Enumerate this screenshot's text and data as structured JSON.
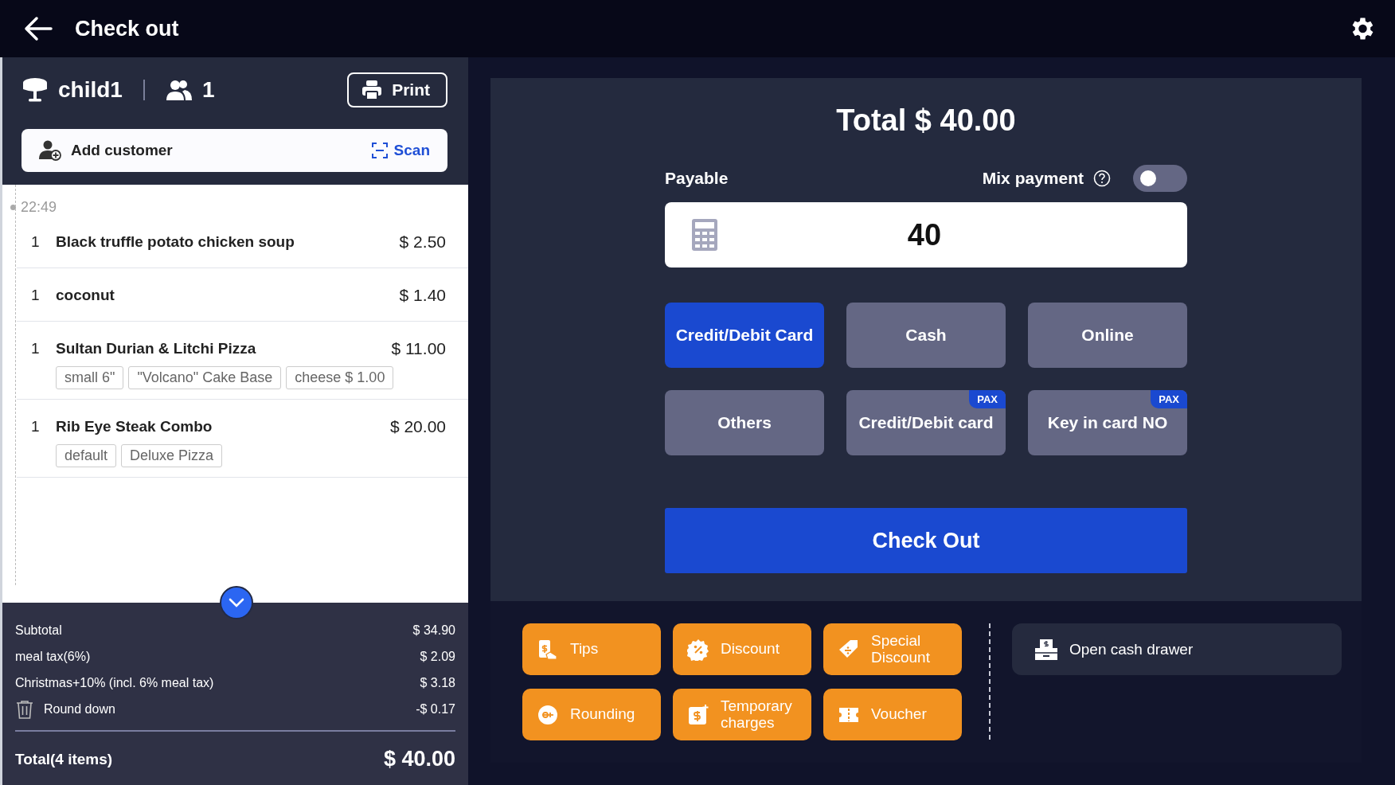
{
  "header": {
    "title": "Check out"
  },
  "table": {
    "name": "child1",
    "guests": "1",
    "print_button": "Print"
  },
  "customer": {
    "label": "Add customer",
    "scan": "Scan"
  },
  "order": {
    "time": "22:49",
    "items": [
      {
        "qty": "1",
        "name": "Black truffle potato chicken soup",
        "price": "$ 2.50"
      },
      {
        "qty": "1",
        "name": "coconut",
        "price": "$ 1.40"
      },
      {
        "qty": "1",
        "name": "Sultan Durian & Litchi Pizza",
        "price": "$ 11.00",
        "options": [
          "small 6\"",
          "\"Volcano\" Cake Base",
          "cheese  $ 1.00"
        ]
      },
      {
        "qty": "1",
        "name": "Rib Eye Steak Combo",
        "price": "$ 20.00",
        "options": [
          "default",
          "Deluxe Pizza"
        ]
      }
    ]
  },
  "summary": {
    "lines": [
      {
        "label": "Subtotal",
        "amount": "$ 34.90",
        "kind": "plain"
      },
      {
        "label": "meal tax(6%)",
        "amount": "$ 2.09",
        "kind": "plain"
      },
      {
        "label": "Christmas+10% (incl. 6% meal tax)",
        "amount": "$ 3.18",
        "kind": "plain"
      },
      {
        "label": "Round down",
        "amount": "-$ 0.17",
        "kind": "removable"
      }
    ],
    "total_label": "Total(4 items)",
    "total": "$ 40.00"
  },
  "payment": {
    "total": "Total $ 40.00",
    "payable_label": "Payable",
    "mix_payment": {
      "label": "Mix payment",
      "on": false
    },
    "amount": "40",
    "methods": [
      {
        "label": "Credit/Debit Card",
        "selected": true
      },
      {
        "label": "Cash",
        "selected": false
      },
      {
        "label": "Online",
        "selected": false
      },
      {
        "label": "Others",
        "selected": false
      },
      {
        "label": "Credit/Debit card",
        "selected": false,
        "badge": "PAX"
      },
      {
        "label": "Key in card NO",
        "selected": false,
        "badge": "PAX"
      }
    ],
    "checkout_button": "Check Out"
  },
  "actions": [
    {
      "label": "Tips"
    },
    {
      "label": "Discount"
    },
    {
      "label": "Special Discount"
    },
    {
      "label": "Rounding"
    },
    {
      "label": "Temporary charges"
    },
    {
      "label": "Voucher"
    }
  ],
  "cash_drawer": "Open cash drawer"
}
